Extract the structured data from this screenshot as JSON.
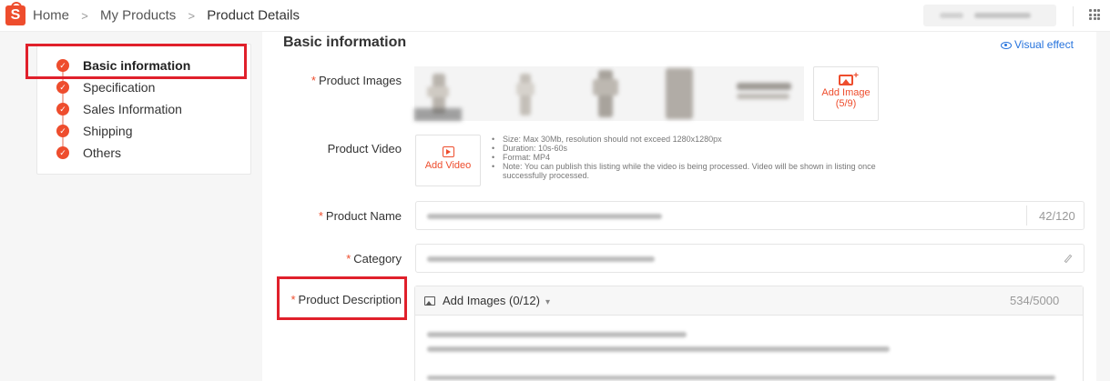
{
  "header": {
    "logo_glyph": "S",
    "breadcrumb": [
      "Home",
      "My Products",
      "Product Details"
    ],
    "separator": ">"
  },
  "sidebar": {
    "steps": [
      {
        "label": "Basic information",
        "active": true
      },
      {
        "label": "Specification",
        "active": false
      },
      {
        "label": "Sales Information",
        "active": false
      },
      {
        "label": "Shipping",
        "active": false
      },
      {
        "label": "Others",
        "active": false
      }
    ],
    "check_glyph": "✓"
  },
  "main": {
    "section_title": "Basic information",
    "visual_effect_label": "Visual effect",
    "required_mark": "*",
    "product_images": {
      "label": "Product Images",
      "add_label": "Add Image",
      "count": "(5/9)"
    },
    "product_video": {
      "label": "Product Video",
      "add_label": "Add Video",
      "notes": [
        "Size: Max 30Mb, resolution should not exceed 1280x1280px",
        "Duration: 10s-60s",
        "Format: MP4",
        "Note: You can publish this listing while the video is being processed. Video will be shown in listing once successfully processed."
      ]
    },
    "product_name": {
      "label": "Product Name",
      "counter": "42/120"
    },
    "category": {
      "label": "Category"
    },
    "product_description": {
      "label": "Product Description",
      "add_images_label": "Add Images (0/12)",
      "counter": "534/5000"
    }
  },
  "colors": {
    "brand": "#ee4d2d",
    "highlight_outline": "#e0202b",
    "link": "#2673dd"
  }
}
